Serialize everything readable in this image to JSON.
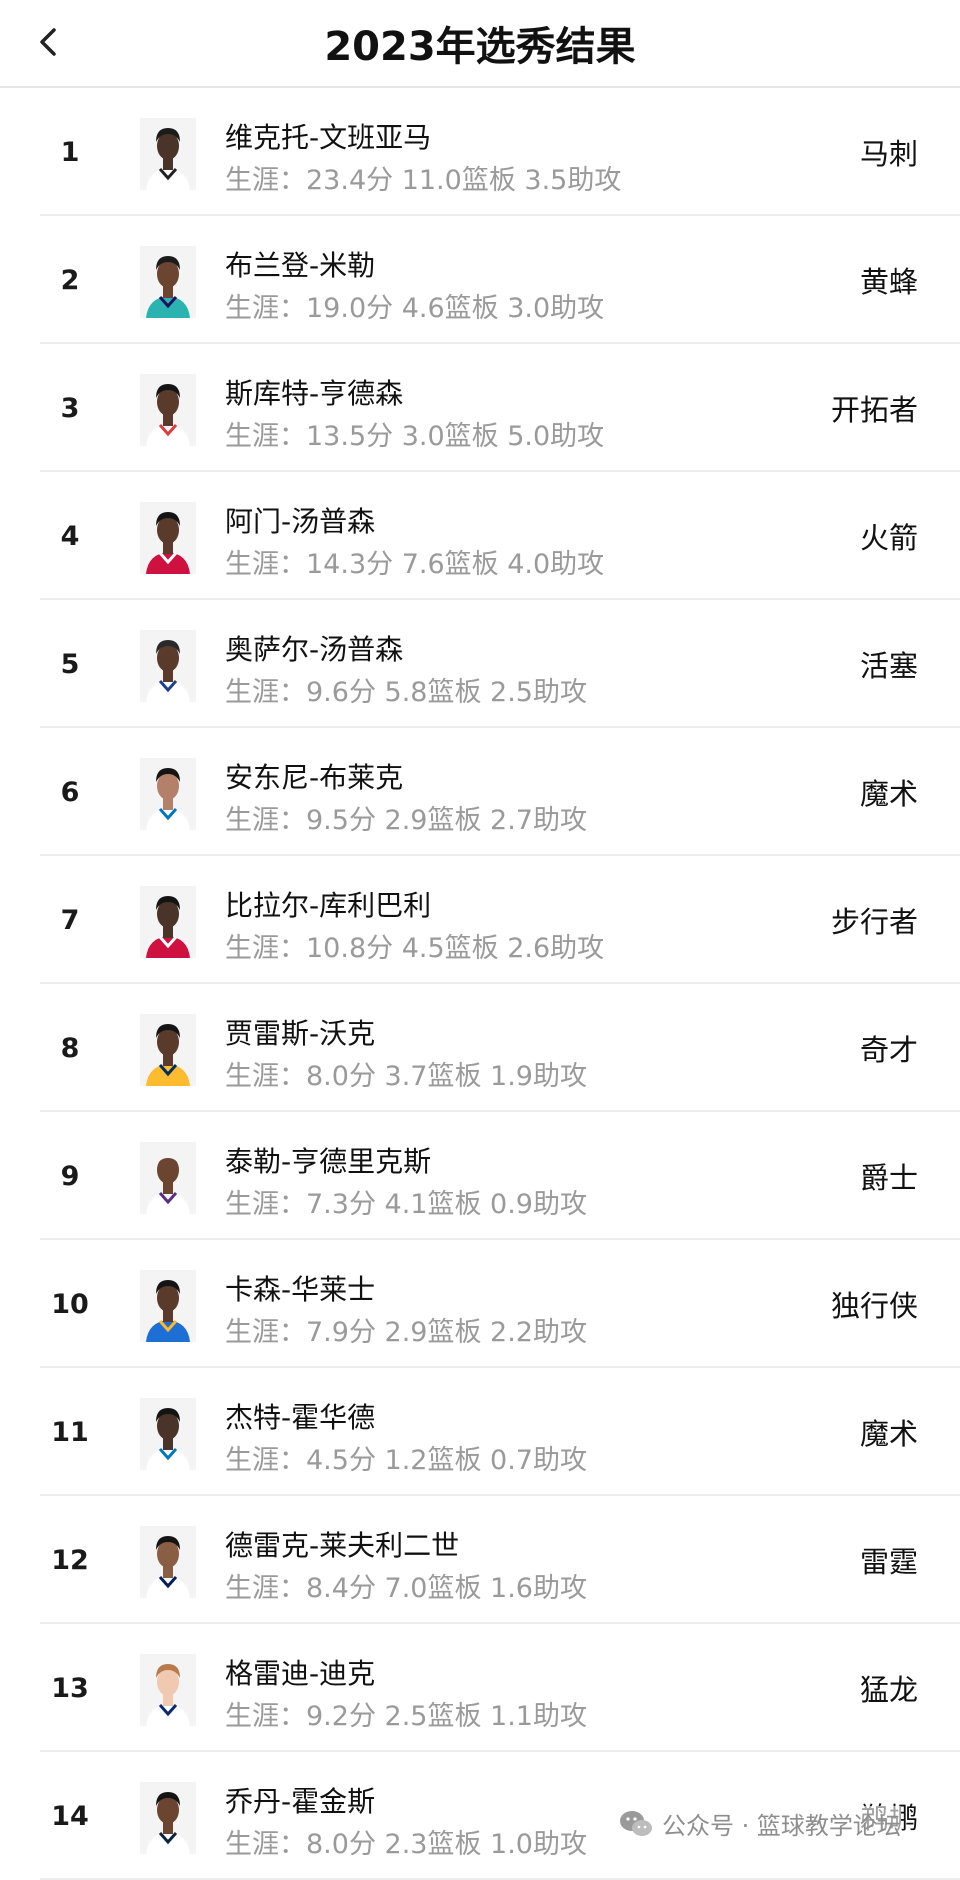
{
  "header": {
    "title": "2023年选秀结果"
  },
  "picks": [
    {
      "rank": "1",
      "name": "维克托-文班亚马",
      "stats": "生涯：23.4分 11.0篮板 3.5助攻",
      "team": "马刺",
      "jersey": "#ffffff",
      "trim": "#222222",
      "skin": "#4a3328",
      "hair": "#1b1b1b"
    },
    {
      "rank": "2",
      "name": "布兰登-米勒",
      "stats": "生涯：19.0分 4.6篮板 3.0助攻",
      "team": "黄蜂",
      "jersey": "#2bb3b1",
      "trim": "#1d1160",
      "skin": "#6b4530",
      "hair": "#1b1b1b"
    },
    {
      "rank": "3",
      "name": "斯库特-亨德森",
      "stats": "生涯：13.5分 3.0篮板 5.0助攻",
      "team": "开拓者",
      "jersey": "#ffffff",
      "trim": "#e03a3e",
      "skin": "#5a3a2a",
      "hair": "#141414"
    },
    {
      "rank": "4",
      "name": "阿门-汤普森",
      "stats": "生涯：14.3分 7.6篮板 4.0助攻",
      "team": "火箭",
      "jersey": "#ce1141",
      "trim": "#ffffff",
      "skin": "#5a3a2a",
      "hair": "#141414"
    },
    {
      "rank": "5",
      "name": "奥萨尔-汤普森",
      "stats": "生涯：9.6分 5.8篮板 2.5助攻",
      "team": "活塞",
      "jersey": "#ffffff",
      "trim": "#1d428a",
      "skin": "#5a3a2a",
      "hair": "#2a2a2a"
    },
    {
      "rank": "6",
      "name": "安东尼-布莱克",
      "stats": "生涯：9.5分 2.9篮板 2.7助攻",
      "team": "魔术",
      "jersey": "#ffffff",
      "trim": "#0077c0",
      "skin": "#b5806a",
      "hair": "#141414"
    },
    {
      "rank": "7",
      "name": "比拉尔-库利巴利",
      "stats": "生涯：10.8分 4.5篮板 2.6助攻",
      "team": "步行者",
      "jersey": "#ce1141",
      "trim": "#ffffff",
      "skin": "#4a3328",
      "hair": "#141414"
    },
    {
      "rank": "8",
      "name": "贾雷斯-沃克",
      "stats": "生涯：8.0分 3.7篮板 1.9助攻",
      "team": "奇才",
      "jersey": "#fdbb30",
      "trim": "#002d62",
      "skin": "#5a3a2a",
      "hair": "#141414"
    },
    {
      "rank": "9",
      "name": "泰勒-亨德里克斯",
      "stats": "生涯：7.3分 4.1篮板 0.9助攻",
      "team": "爵士",
      "jersey": "#ffffff",
      "trim": "#5a2d81",
      "skin": "#6b4530",
      "hair": "#f4f4f4"
    },
    {
      "rank": "10",
      "name": "卡森-华莱士",
      "stats": "生涯：7.9分 2.9篮板 2.2助攻",
      "team": "独行侠",
      "jersey": "#1d6fd6",
      "trim": "#fdb927",
      "skin": "#5a3a2a",
      "hair": "#141414"
    },
    {
      "rank": "11",
      "name": "杰特-霍华德",
      "stats": "生涯：4.5分 1.2篮板 0.7助攻",
      "team": "魔术",
      "jersey": "#ffffff",
      "trim": "#0077c0",
      "skin": "#4a3328",
      "hair": "#141414"
    },
    {
      "rank": "12",
      "name": "德雷克-莱夫利二世",
      "stats": "生涯：8.4分 7.0篮板 1.6助攻",
      "team": "雷霆",
      "jersey": "#ffffff",
      "trim": "#00205b",
      "skin": "#8a5e44",
      "hair": "#141414"
    },
    {
      "rank": "13",
      "name": "格雷迪-迪克",
      "stats": "生涯：9.2分 2.5篮板 1.1助攻",
      "team": "猛龙",
      "jersey": "#ffffff",
      "trim": "#0a2a6b",
      "skin": "#f0c9b0",
      "hair": "#b77a48"
    },
    {
      "rank": "14",
      "name": "乔丹-霍金斯",
      "stats": "生涯：8.0分 2.3篮板 1.0助攻",
      "team": "鹈鹕",
      "jersey": "#ffffff",
      "trim": "#0c2340",
      "skin": "#6b4530",
      "hair": "#141414"
    }
  ],
  "watermark": {
    "text": "公众号 · 篮球教学论坛",
    "icon": "wechat-icon"
  }
}
